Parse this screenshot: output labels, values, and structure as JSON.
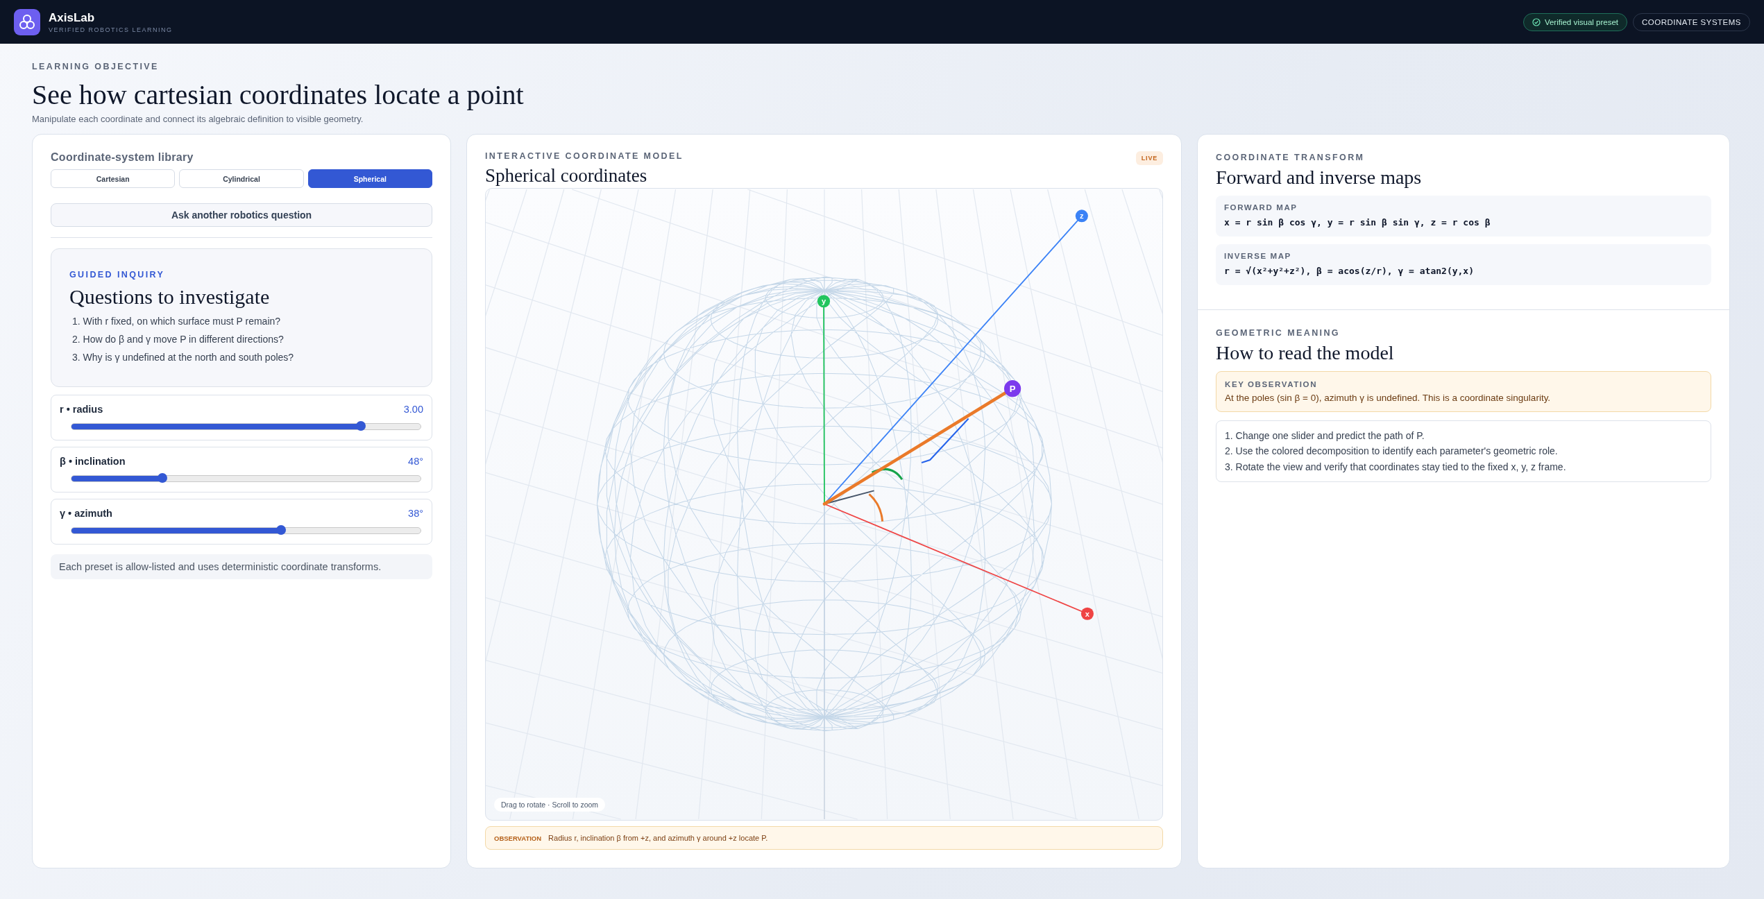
{
  "app": {
    "name": "AxisLab",
    "tagline": "VERIFIED ROBOTICS LEARNING"
  },
  "header_actions": [
    {
      "kind": "status",
      "label": "Verified visual preset"
    },
    {
      "kind": "link",
      "label": "COORDINATE SYSTEMS"
    }
  ],
  "page": {
    "eyebrow": "LEARNING OBJECTIVE",
    "title": "See how cartesian coordinates locate a point",
    "subtitle": "Manipulate each coordinate and connect its algebraic definition to visible geometry."
  },
  "library": {
    "title": "Coordinate-system library",
    "tabs": [
      {
        "label": "Cartesian",
        "selected": false
      },
      {
        "label": "Cylindrical",
        "selected": false
      },
      {
        "label": "Spherical",
        "selected": true
      }
    ],
    "ask_button": "Ask another robotics question",
    "inquiry": {
      "eyebrow": "GUIDED INQUIRY",
      "title": "Questions to investigate",
      "questions": [
        "1. With r fixed, on which surface must P remain?",
        "2. How do β and γ move P in different directions?",
        "3. Why is γ undefined at the north and south poles?"
      ]
    },
    "sliders": [
      {
        "label": "r • radius",
        "reading": "3.00",
        "level": 0.83
      },
      {
        "label": "β • inclination",
        "reading": "48°",
        "level": 0.26
      },
      {
        "label": "γ • azimuth",
        "reading": "38°",
        "level": 0.6
      }
    ],
    "note": "Each preset is allow-listed and uses deterministic coordinate transforms."
  },
  "model": {
    "eyebrow": "INTERACTIVE COORDINATE MODEL",
    "title": "Spherical coordinates",
    "badge": "LIVE",
    "axes": [
      {
        "kind": "z",
        "label": "z",
        "color": "#3b82f6"
      },
      {
        "kind": "y",
        "label": "y",
        "color": "#22c55e"
      },
      {
        "kind": "x",
        "label": "x",
        "color": "#ef4444"
      }
    ],
    "point": {
      "label": "P"
    },
    "hint": "Drag to rotate · Scroll to zoom",
    "observation": {
      "label": "OBSERVATION",
      "text": "Radius r, inclination β from +z, and azimuth γ around +z locate P."
    }
  },
  "transform": {
    "eyebrow": "COORDINATE TRANSFORM",
    "title": "Forward and inverse maps",
    "maps": [
      {
        "label": "FORWARD MAP",
        "formula": "x = r sin β cos γ, y = r sin β sin γ, z = r cos β"
      },
      {
        "label": "INVERSE MAP",
        "formula": "r = √(x²+y²+z²), β = acos(z/r), γ = atan2(y,x)"
      }
    ]
  },
  "meaning": {
    "eyebrow": "GEOMETRIC MEANING",
    "title": "How to read the model",
    "key": {
      "label": "KEY OBSERVATION",
      "text": "At the poles (sin β = 0), azimuth γ is undefined. This is a coordinate singularity."
    },
    "steps": [
      "1. Change one slider and predict the path of P.",
      "2. Use the colored decomposition to identify each parameter's geometric role.",
      "3. Rotate the view and verify that coordinates stay tied to the fixed x, y, z frame."
    ]
  }
}
